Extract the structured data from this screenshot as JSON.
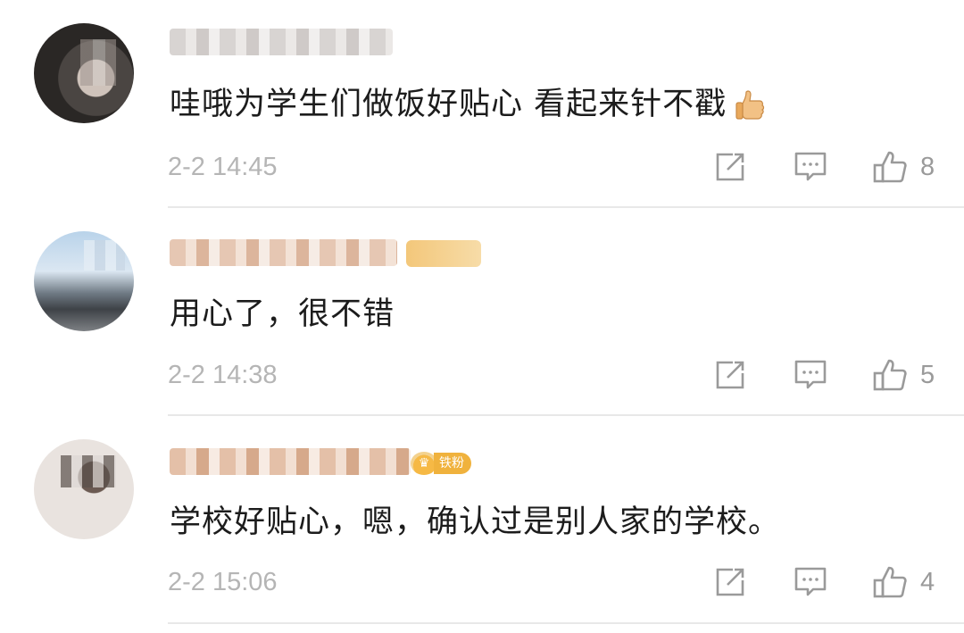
{
  "comments": [
    {
      "text": "哇哦为学生们做饭好贴心 看起来针不戳",
      "emoji": "thumbs-up-icon",
      "time": "2-2 14:45",
      "likes": "8"
    },
    {
      "text": "用心了，很不错",
      "time": "2-2 14:38",
      "likes": "5"
    },
    {
      "text": "学校好贴心，嗯，确认过是别人家的学校。",
      "badge": "铁粉",
      "time": "2-2 15:06",
      "likes": "4"
    }
  ],
  "icons": {
    "share": "share-icon",
    "reply": "comment-icon",
    "like": "thumbs-up-icon"
  },
  "colors": {
    "text": "#1c1c1c",
    "meta": "#b5b5b5",
    "icon": "#9a9a9a",
    "badge": "#f0b23d"
  }
}
